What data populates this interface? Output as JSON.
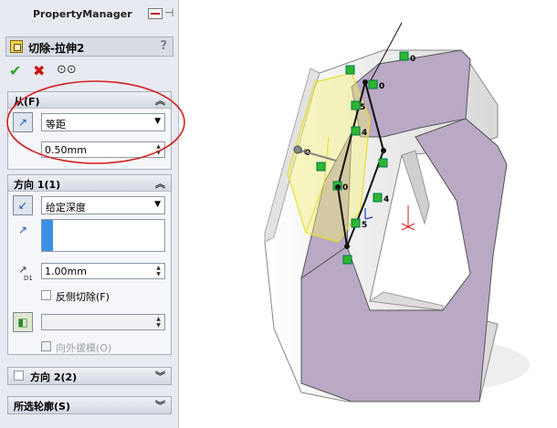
{
  "panel": {
    "title": "PropertyManager",
    "feature_name": "切除-拉伸2",
    "help": "?",
    "actions": {
      "ok": "✔",
      "cancel": "✖",
      "preview": "⊙⊙"
    }
  },
  "from_group": {
    "label": "从(F)",
    "start_condition": "等距",
    "offset": "0.50mm"
  },
  "dir1_group": {
    "label": "方向 1(1)",
    "end_condition": "给定深度",
    "depth_prefix": "D1",
    "depth": "1.00mm",
    "flip_side_label": "反侧切除(F)",
    "draft_outward_label": "向外拔模(O)"
  },
  "dir2_group": {
    "label": "方向 2(2)"
  },
  "contours_group": {
    "label": "所选轮廓(S)"
  },
  "sketch_labels": [
    "0",
    "0",
    "5",
    "4",
    "0",
    "4",
    "5",
    "0"
  ],
  "colors": {
    "accent_red": "#d42020",
    "face": "#b9a9c4",
    "highlight": "#f5f07a"
  }
}
